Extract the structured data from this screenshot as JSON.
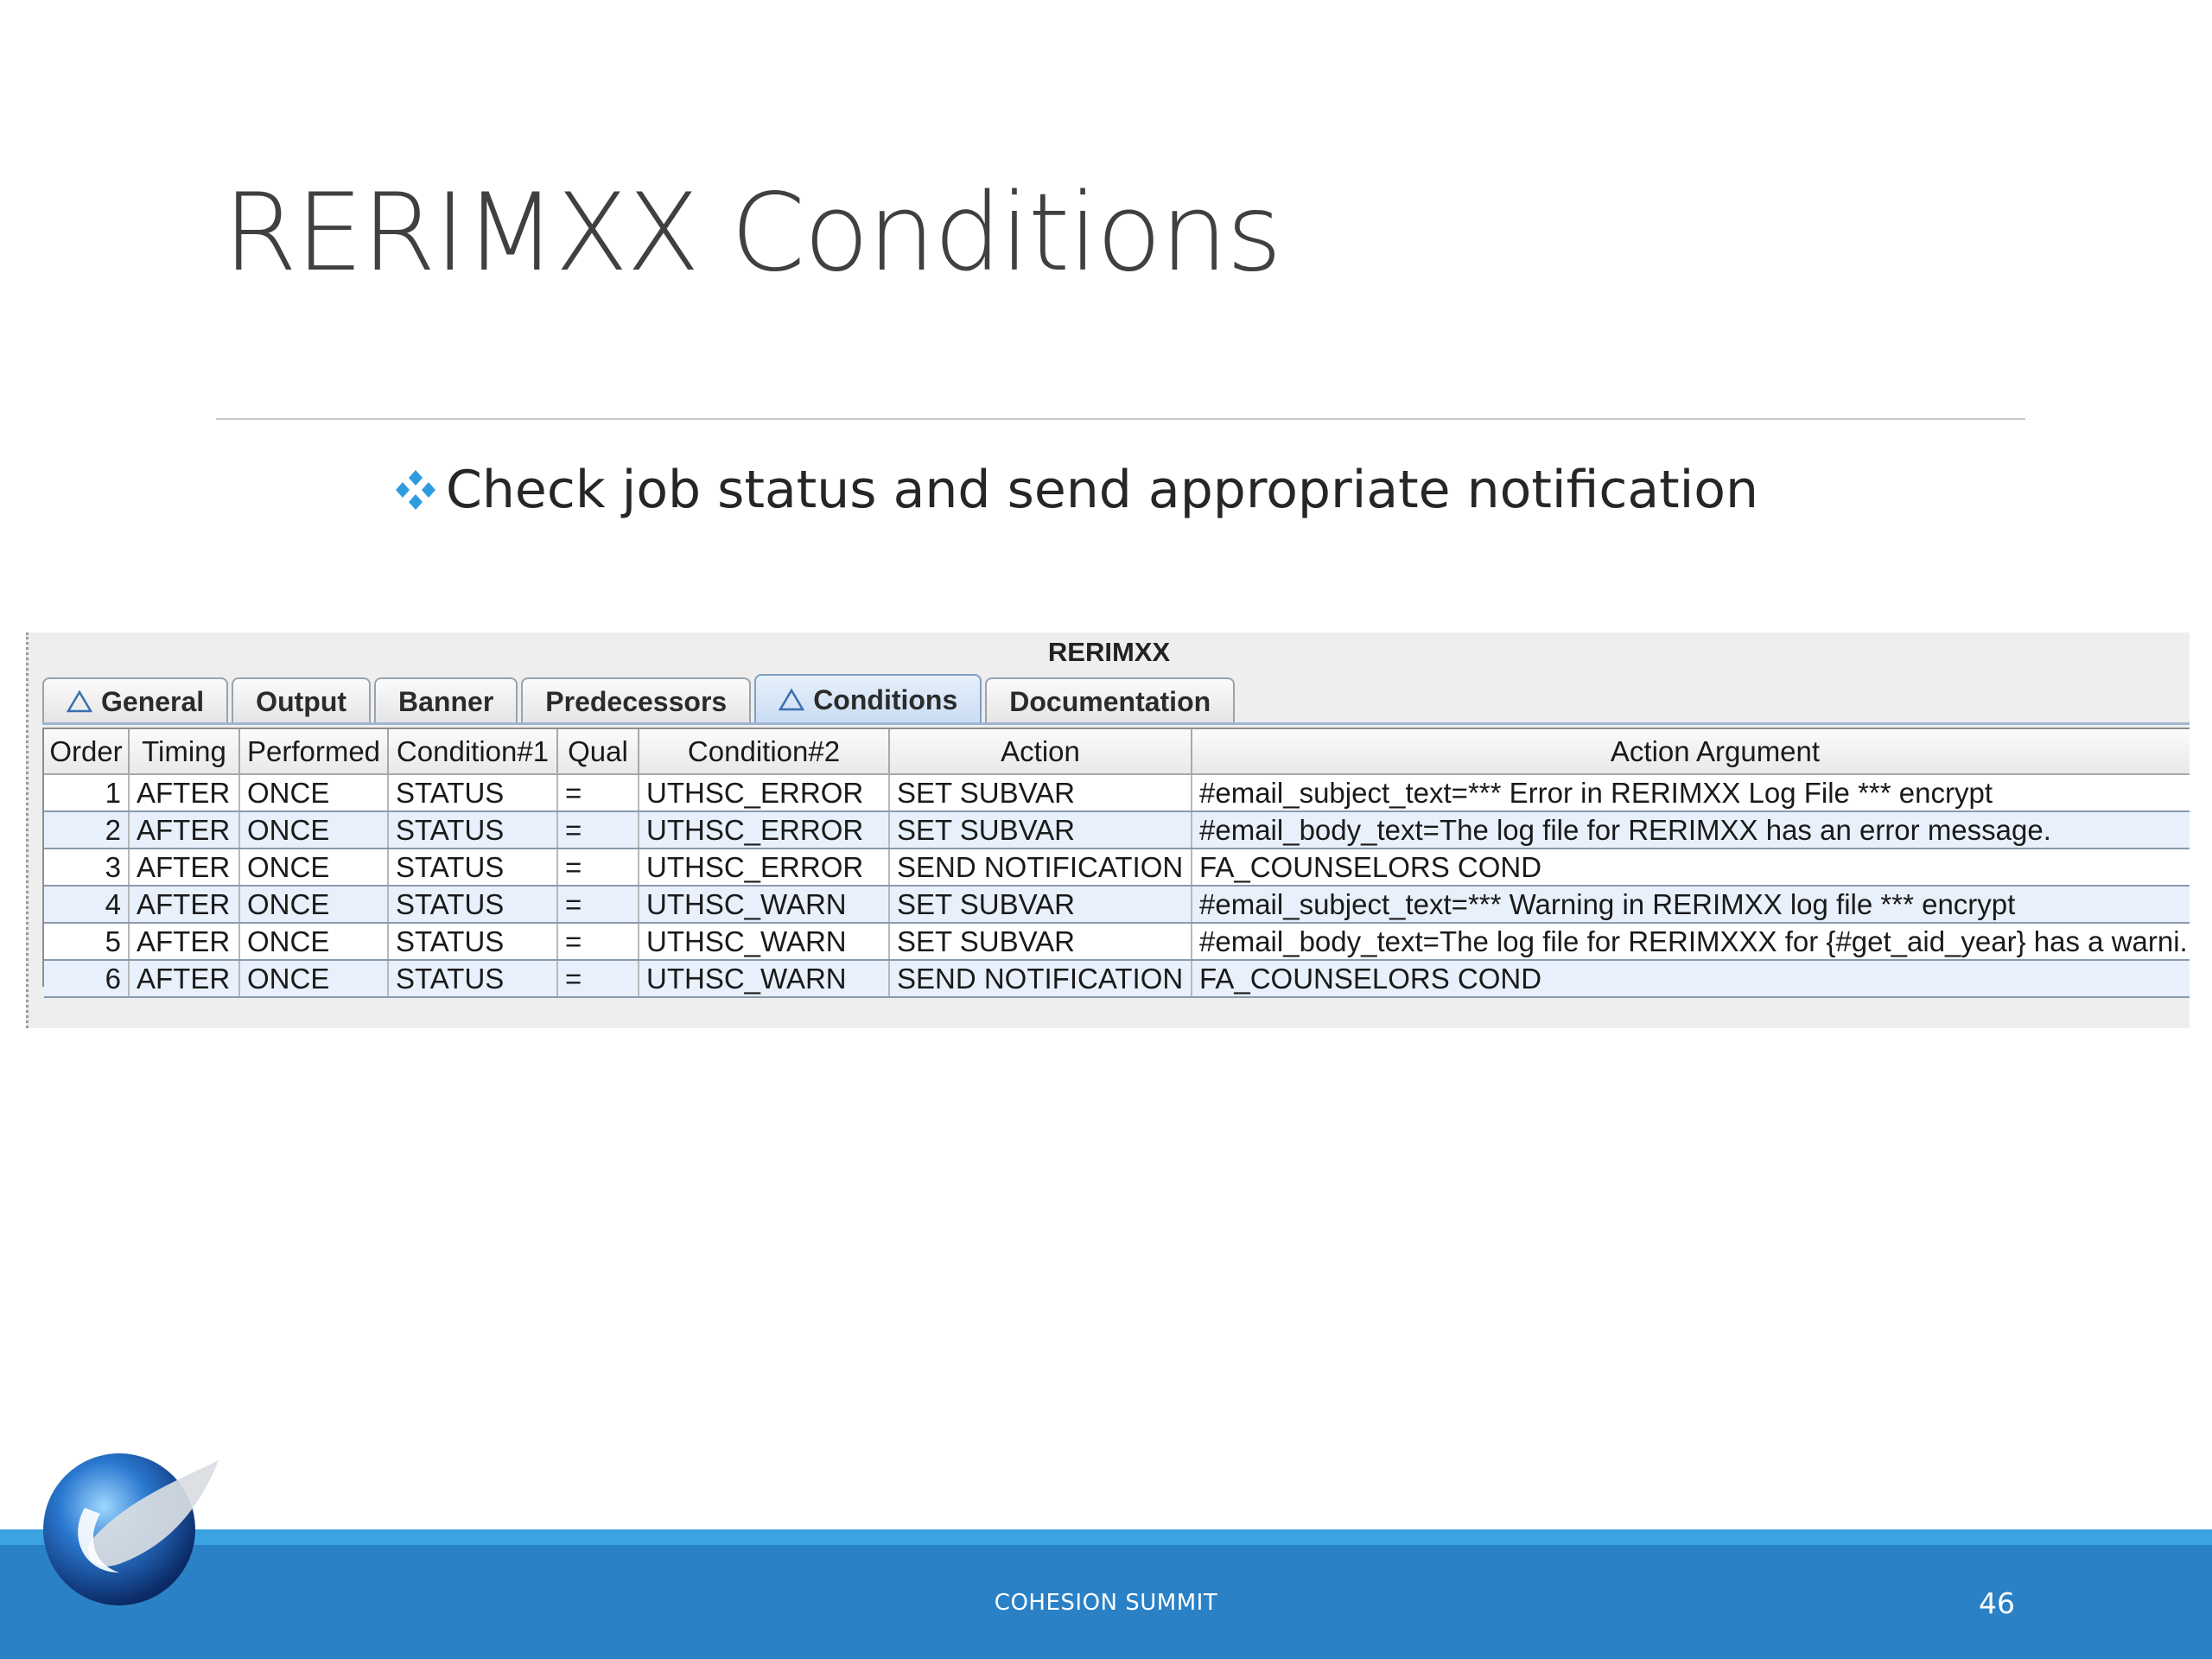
{
  "slide": {
    "title": "RERIMXX Conditions",
    "bullet": "Check job status and send appropriate notification"
  },
  "app": {
    "window_title": "RERIMXX",
    "tabs": [
      {
        "label": "General",
        "warning": true,
        "active": false
      },
      {
        "label": "Output",
        "warning": false,
        "active": false
      },
      {
        "label": "Banner",
        "warning": false,
        "active": false
      },
      {
        "label": "Predecessors",
        "warning": false,
        "active": false
      },
      {
        "label": "Conditions",
        "warning": true,
        "active": true
      },
      {
        "label": "Documentation",
        "warning": false,
        "active": false
      }
    ],
    "table": {
      "columns": [
        "Order",
        "Timing",
        "Performed",
        "Condition#1",
        "Qual",
        "Condition#2",
        "Action",
        "Action Argument"
      ],
      "rows": [
        [
          "1",
          "AFTER",
          "ONCE",
          "STATUS",
          "=",
          "UTHSC_ERROR",
          "SET SUBVAR",
          "#email_subject_text=*** Error in RERIMXX Log File *** encrypt"
        ],
        [
          "2",
          "AFTER",
          "ONCE",
          "STATUS",
          "=",
          "UTHSC_ERROR",
          "SET SUBVAR",
          "#email_body_text=The log file for RERIMXX has an error message."
        ],
        [
          "3",
          "AFTER",
          "ONCE",
          "STATUS",
          "=",
          "UTHSC_ERROR",
          "SEND NOTIFICATION",
          "FA_COUNSELORS COND"
        ],
        [
          "4",
          "AFTER",
          "ONCE",
          "STATUS",
          "=",
          "UTHSC_WARN",
          "SET SUBVAR",
          "#email_subject_text=*** Warning in RERIMXX log file *** encrypt"
        ],
        [
          "5",
          "AFTER",
          "ONCE",
          "STATUS",
          "=",
          "UTHSC_WARN",
          "SET SUBVAR",
          "#email_body_text=The log file for RERIMXXX for {#get_aid_year} has a warni..."
        ],
        [
          "6",
          "AFTER",
          "ONCE",
          "STATUS",
          "=",
          "UTHSC_WARN",
          "SEND NOTIFICATION",
          "FA_COUNSELORS COND"
        ]
      ]
    }
  },
  "footer": {
    "text": "COHESION SUMMIT",
    "page_number": "46"
  },
  "colors": {
    "footer_band": "#2a81c6",
    "footer_accent": "#3aa3e0",
    "bullet": "#2e9ae0",
    "row_alt": "#e8f0fb"
  },
  "icons": {
    "bullet": "diamond-cluster-icon",
    "tab_warning": "warning-triangle-icon",
    "logo": "globe-swoosh-logo"
  }
}
